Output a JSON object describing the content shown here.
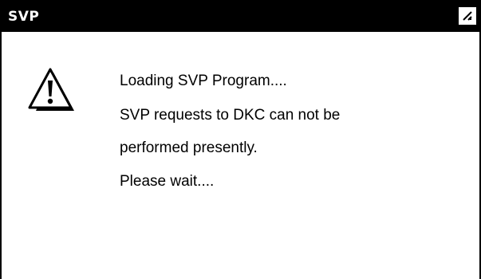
{
  "window": {
    "title": "SVP",
    "resize_icon": "resize-grip-icon"
  },
  "dialog": {
    "icon": "warning-icon",
    "lines": [
      "Loading SVP Program....",
      "SVP requests to DKC can not be",
      "performed presently.",
      "Please wait...."
    ]
  },
  "colors": {
    "titlebar_bg": "#000000",
    "titlebar_text": "#ffffff",
    "body_bg": "#ffffff",
    "text": "#000000"
  }
}
